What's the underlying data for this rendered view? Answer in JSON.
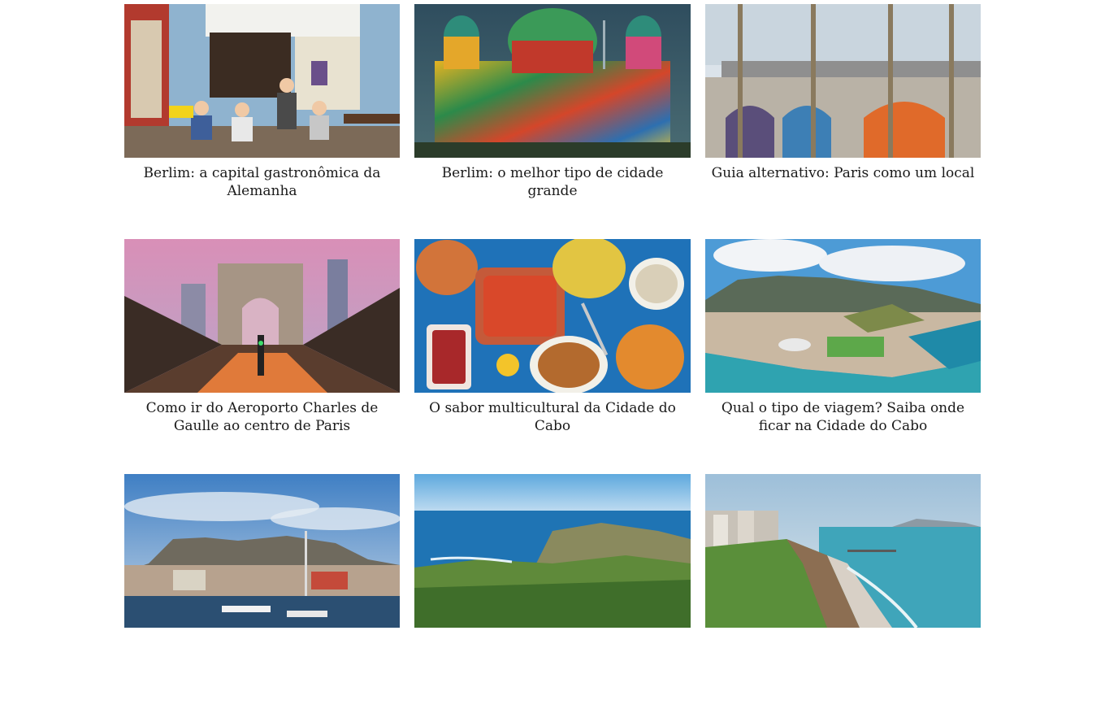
{
  "articles": [
    {
      "title": "Berlim: a capital gastronômica da Alemanha",
      "image": "berlin-cafe-street-scene"
    },
    {
      "title": "Berlim: o melhor tipo de cidade grande",
      "image": "berlin-cathedral-festival-of-lights"
    },
    {
      "title": "Guia alternativo: Paris como um local",
      "image": "paris-arches-street-art"
    },
    {
      "title": "Como ir do Aeroporto Charles de Gaulle ao centro de Paris",
      "image": "arc-de-triomphe-champs-elysees"
    },
    {
      "title": "O sabor multicultural da Cidade do Cabo",
      "image": "cape-malay-food-table"
    },
    {
      "title": "Qual o tipo de viagem? Saiba onde ficar na Cidade do Cabo",
      "image": "cape-town-aerial-view"
    },
    {
      "title": "",
      "image": "cape-town-waterfront-table-mountain"
    },
    {
      "title": "",
      "image": "cape-point-coastline"
    },
    {
      "title": "",
      "image": "lima-miraflores-coast"
    }
  ]
}
